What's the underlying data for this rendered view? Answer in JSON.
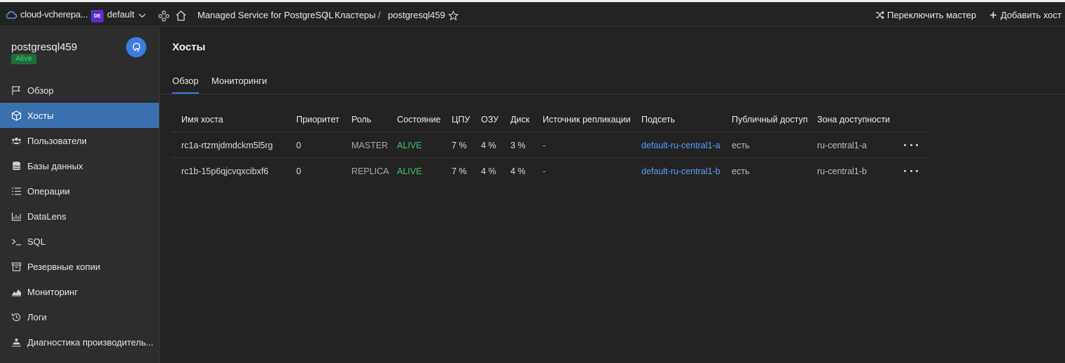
{
  "topbar": {
    "cloud_name": "cloud-vcherepa...",
    "folder_badge": "DE",
    "folder_name": "default",
    "breadcrumbs": [
      "Managed Service for PostgreSQL",
      "Кластеры",
      "postgresql459"
    ],
    "separator": "/",
    "switch_master": "Переключить мастер",
    "add_host": "Добавить хост"
  },
  "sidebar": {
    "cluster_name": "postgresql459",
    "status": "Alive",
    "items": [
      {
        "label": "Обзор",
        "icon": "flag-icon"
      },
      {
        "label": "Хосты",
        "icon": "cube-icon"
      },
      {
        "label": "Пользователи",
        "icon": "users-icon"
      },
      {
        "label": "Базы данных",
        "icon": "database-icon"
      },
      {
        "label": "Операции",
        "icon": "list-icon"
      },
      {
        "label": "DataLens",
        "icon": "chart-icon"
      },
      {
        "label": "SQL",
        "icon": "terminal-icon"
      },
      {
        "label": "Резервные копии",
        "icon": "archive-icon"
      },
      {
        "label": "Мониторинг",
        "icon": "area-chart-icon"
      },
      {
        "label": "Логи",
        "icon": "history-icon"
      },
      {
        "label": "Диагностика производитель...",
        "icon": "diagnostics-icon"
      }
    ]
  },
  "main": {
    "title": "Хосты",
    "tabs": [
      "Обзор",
      "Мониторинги"
    ],
    "table": {
      "headers": [
        "Имя хоста",
        "Приоритет",
        "Роль",
        "Состояние",
        "ЦПУ",
        "ОЗУ",
        "Диск",
        "Источник репликации",
        "Подсеть",
        "Публичный доступ",
        "Зона доступности"
      ],
      "rows": [
        [
          "rc1a-rtzmjdmdckm5l5rg",
          "0",
          "MASTER",
          "ALIVE",
          "7 %",
          "4 %",
          "3 %",
          "-",
          "default-ru-central1-a",
          "есть",
          "ru-central1-a"
        ],
        [
          "rc1b-15p6qjcvqxcibxf6",
          "0",
          "REPLICA",
          "ALIVE",
          "7 %",
          "4 %",
          "4 %",
          "-",
          "default-ru-central1-b",
          "есть",
          "ru-central1-b"
        ]
      ]
    }
  },
  "colors": {
    "accent": "#3b7ce0",
    "active_nav": "#3a6fb0",
    "alive": "#3cc96c",
    "link": "#5a9bff",
    "folder_badge": "#5a2fc9"
  }
}
